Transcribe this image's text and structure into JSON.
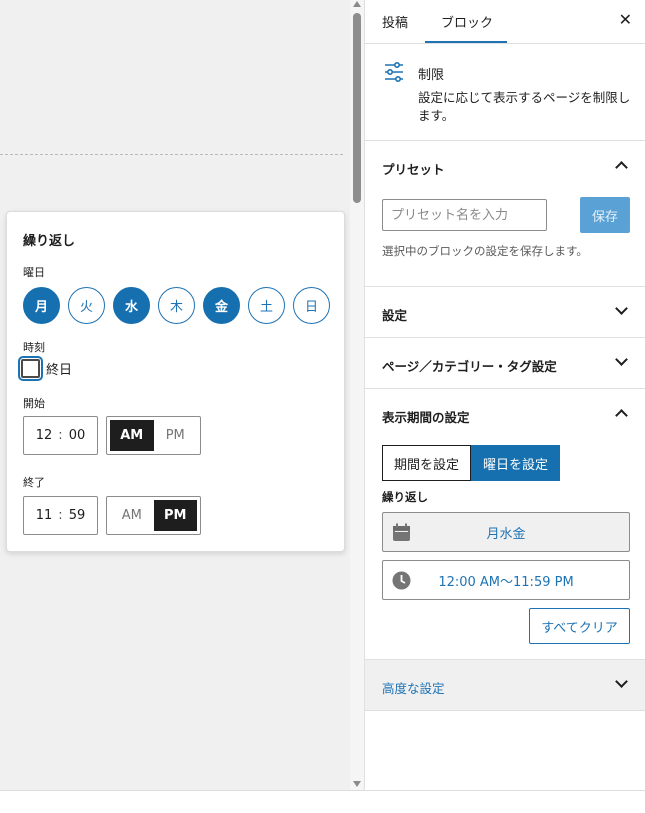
{
  "popover": {
    "title": "繰り返し",
    "weekday_label": "曜日",
    "days": [
      {
        "label": "月",
        "selected": true
      },
      {
        "label": "火",
        "selected": false
      },
      {
        "label": "水",
        "selected": true
      },
      {
        "label": "木",
        "selected": false
      },
      {
        "label": "金",
        "selected": true
      },
      {
        "label": "土",
        "selected": false
      },
      {
        "label": "日",
        "selected": false
      }
    ],
    "time_label": "時刻",
    "all_day_label": "終日",
    "start_label": "開始",
    "start_hour": "12",
    "start_minute": "00",
    "end_label": "終了",
    "end_hour": "11",
    "end_minute": "59",
    "am": "AM",
    "pm": "PM",
    "start_period": "AM",
    "end_period": "PM"
  },
  "sidebar": {
    "tabs": [
      "投稿",
      "ブロック"
    ],
    "active_tab": "ブロック",
    "close_symbol": "✕",
    "block_name": "制限",
    "block_description": "設定に応じて表示するページを制限します。",
    "preset": {
      "title": "プリセット",
      "placeholder": "プリセット名を入力",
      "save_label": "保存",
      "help": "選択中のブロックの設定を保存します。"
    },
    "settings_title": "設定",
    "page_category_title": "ページ／カテゴリー・タグ設定",
    "display_period": {
      "title": "表示期間の設定",
      "mode_period": "期間を設定",
      "mode_weekday": "曜日を設定",
      "repeat_label": "繰り返し",
      "days_value": "月水金",
      "time_value": "12:00 AM～11:59 PM",
      "clear_label": "すべてクリア"
    },
    "advanced_title": "高度な設定"
  },
  "colors": {
    "accent": "#1670b0",
    "dark": "#1e1e1e",
    "canvas": "#f0f0f0"
  }
}
